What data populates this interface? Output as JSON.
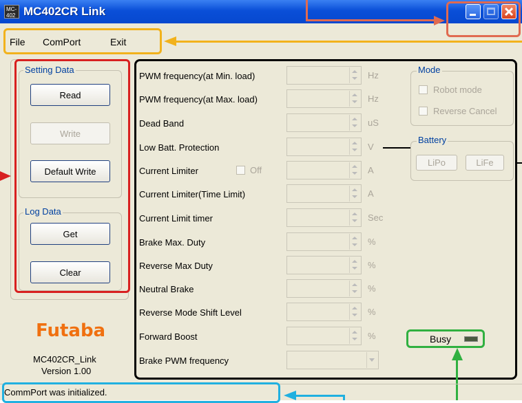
{
  "window": {
    "title": "MC402CR Link",
    "icon_text": "MC-402",
    "controls": [
      "minimize-icon",
      "maximize-icon",
      "close-icon"
    ]
  },
  "menu": {
    "file": "File",
    "comport": "ComPort",
    "exit": "Exit"
  },
  "setting_data": {
    "label": "Setting Data",
    "read": "Read",
    "write": "Write",
    "default_write": "Default Write"
  },
  "log_data": {
    "label": "Log Data",
    "get": "Get",
    "clear": "Clear"
  },
  "brand": {
    "logo": "Futaba",
    "app_name": "MC402CR_Link",
    "version": "Version 1.00"
  },
  "params": [
    {
      "label": "PWM frequency(at Min. load)",
      "unit": "Hz"
    },
    {
      "label": "PWM frequency(at Max. load)",
      "unit": "Hz"
    },
    {
      "label": "Dead Band",
      "unit": "uS"
    },
    {
      "label": "Low Batt. Protection",
      "unit": "V"
    },
    {
      "label": "Current Limiter",
      "unit": "A",
      "checkbox": "Off"
    },
    {
      "label": "Current Limiter(Time Limit)",
      "unit": "A"
    },
    {
      "label": "Current Limit timer",
      "unit": "Sec"
    },
    {
      "label": "Brake Max. Duty",
      "unit": "%"
    },
    {
      "label": "Reverse Max Duty",
      "unit": "%"
    },
    {
      "label": "Neutral Brake",
      "unit": "%"
    },
    {
      "label": "Reverse Mode Shift Level",
      "unit": "%"
    },
    {
      "label": "Forward Boost",
      "unit": "%"
    },
    {
      "label": "Brake PWM frequency",
      "unit": ""
    }
  ],
  "mode": {
    "label": "Mode",
    "robot_mode": "Robot mode",
    "reverse_cancel": "Reverse Cancel"
  },
  "battery": {
    "label": "Battery",
    "lipo": "LiPo",
    "life": "LiFe"
  },
  "busy": {
    "label": "Busy"
  },
  "status": {
    "text": "CommPort was initialized."
  },
  "colors": {
    "titlebar": "#0a4fd8",
    "annot_orange_red": "#e06a50",
    "annot_yellow": "#f2b21c",
    "annot_red": "#d82020",
    "annot_black": "#000000",
    "annot_green": "#30b040",
    "annot_cyan": "#20b0e0",
    "futaba_orange": "#f07010"
  }
}
